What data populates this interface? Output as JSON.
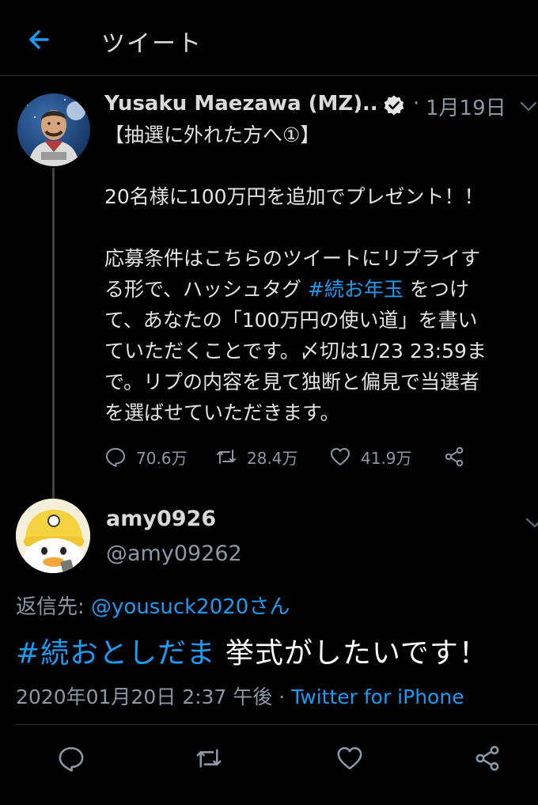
{
  "header": {
    "title": "ツイート",
    "back_icon": "arrow-left-icon"
  },
  "colors": {
    "background": "#000000",
    "link": "#1d9bf0",
    "secondary": "#8b98a5",
    "divider": "#2f3336"
  },
  "parent_tweet": {
    "display_name": "Yusaku Maezawa (MZ)",
    "name_ellipsis": "...",
    "dot": "·",
    "date": "1月19日",
    "body_lines": [
      {
        "text": "【抽選に外れた方へ①】"
      },
      {
        "text": ""
      },
      {
        "text": "20名様に100万円を追加でプレゼント！！"
      },
      {
        "text": ""
      },
      {
        "text": "応募条件はこちらのツイートにリプライす"
      },
      {
        "pre": "る形で、ハッシュタグ ",
        "hashtag": "#続お年玉",
        "post": " をつけ"
      },
      {
        "text": "て、あなたの「100万円の使い道」を書い"
      },
      {
        "text": "ていただくことです。〆切は1/23 23:59ま"
      },
      {
        "text": "で。リプの内容を見て独断と偏見で当選者"
      },
      {
        "text": "を選ばせていただきます。"
      }
    ],
    "actions": {
      "replies": "70.6万",
      "retweets": "28.4万",
      "likes": "41.9万"
    }
  },
  "reply_tweet": {
    "display_name": "amy0926",
    "handle": "@amy09262",
    "reply_to_label": "返信先: ",
    "reply_to_mention": "@yousuck2020さん",
    "hashtag": "#続おとしだま",
    "text": " 挙式がしたいです！",
    "timestamp": "2020年01月20日 2:37 午後 · ",
    "source": "Twitter for iPhone"
  }
}
